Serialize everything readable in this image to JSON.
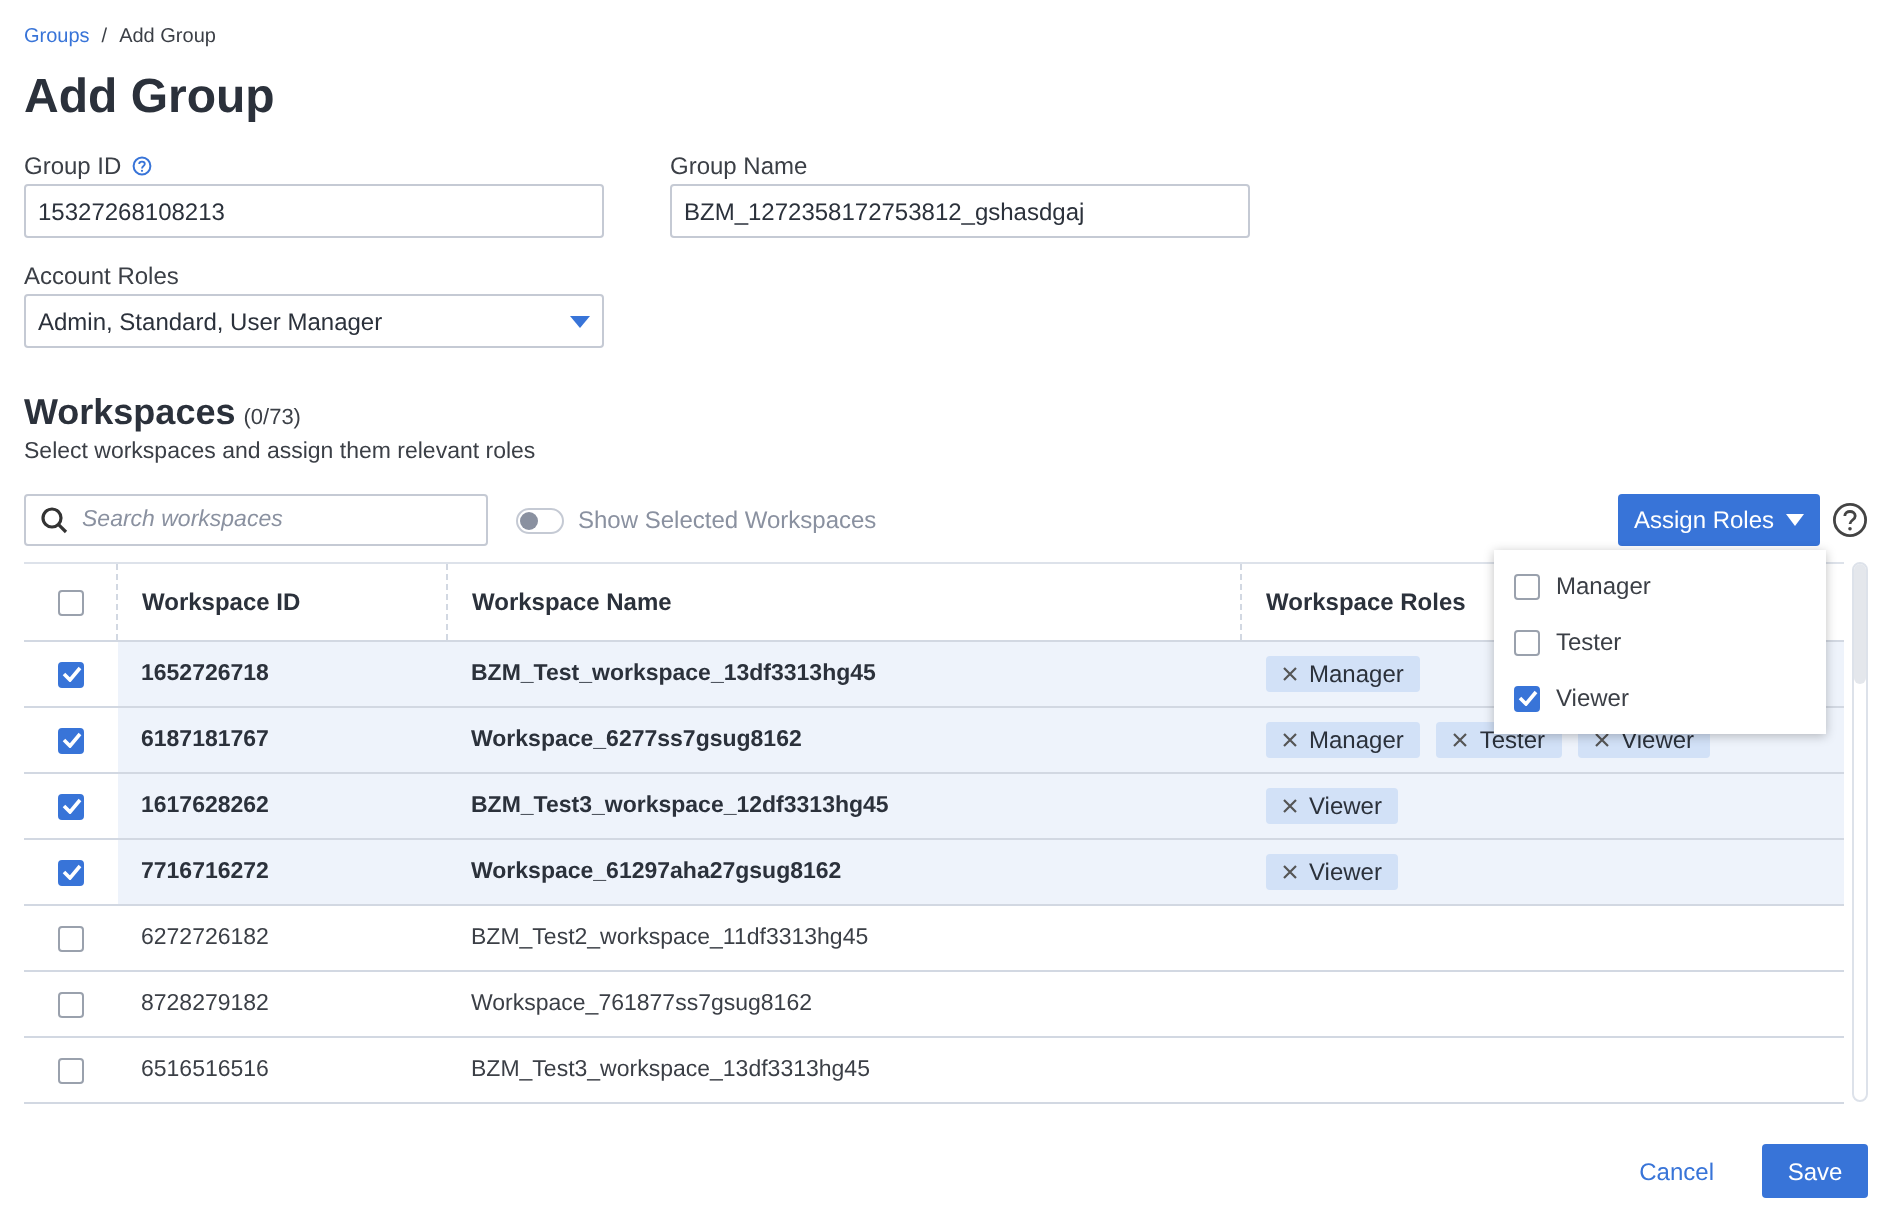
{
  "breadcrumb_separator": "/",
  "breadcrumb": [
    {
      "label": "Groups",
      "kind": "link"
    },
    {
      "label": "Add Group",
      "kind": "current"
    }
  ],
  "title": "Add Group",
  "fields": [
    {
      "label": "Group ID",
      "help": true,
      "value": "15327268108213",
      "kind": "text"
    },
    {
      "label": "Group Name",
      "help": false,
      "value": "BZM_1272358172753812_gshasdgaj",
      "kind": "text"
    },
    {
      "label": "Account Roles",
      "help": false,
      "value": "Admin, Standard, User Manager",
      "kind": "select"
    }
  ],
  "workspaces": {
    "title": "Workspaces",
    "count": "(0/73)",
    "subtitle": "Select workspaces and assign them relevant roles",
    "search": {
      "placeholder": "Search workspaces"
    },
    "toggle": {
      "label": "Show Selected Workspaces",
      "on": false
    },
    "assign_button": "Assign Roles",
    "role_menu": [
      {
        "label": "Manager",
        "checked": false
      },
      {
        "label": "Tester",
        "checked": false
      },
      {
        "label": "Viewer",
        "checked": true
      }
    ],
    "table": {
      "header_checked": false,
      "columns": [
        "Workspace ID",
        "Workspace Name",
        "Workspace Roles"
      ],
      "rows": [
        {
          "selected": true,
          "id": "1652726718",
          "name": "BZM_Test_workspace_13df3313hg45",
          "roles": [
            "Manager"
          ]
        },
        {
          "selected": true,
          "id": "6187181767",
          "name": "Workspace_6277ss7gsug8162",
          "roles": [
            "Manager",
            "Tester",
            "Viewer"
          ]
        },
        {
          "selected": true,
          "id": "1617628262",
          "name": "BZM_Test3_workspace_12df3313hg45",
          "roles": [
            "Viewer"
          ]
        },
        {
          "selected": true,
          "id": "7716716272",
          "name": "Workspace_61297aha27gsug8162",
          "roles": [
            "Viewer"
          ]
        },
        {
          "selected": false,
          "id": "6272726182",
          "name": "BZM_Test2_workspace_11df3313hg45",
          "roles": []
        },
        {
          "selected": false,
          "id": "8728279182",
          "name": "Workspace_761877ss7gsug8162",
          "roles": []
        },
        {
          "selected": false,
          "id": "6516516516",
          "name": "BZM_Test3_workspace_13df3313hg45",
          "roles": []
        }
      ]
    }
  },
  "footer": {
    "cancel": "Cancel",
    "save": "Save"
  }
}
